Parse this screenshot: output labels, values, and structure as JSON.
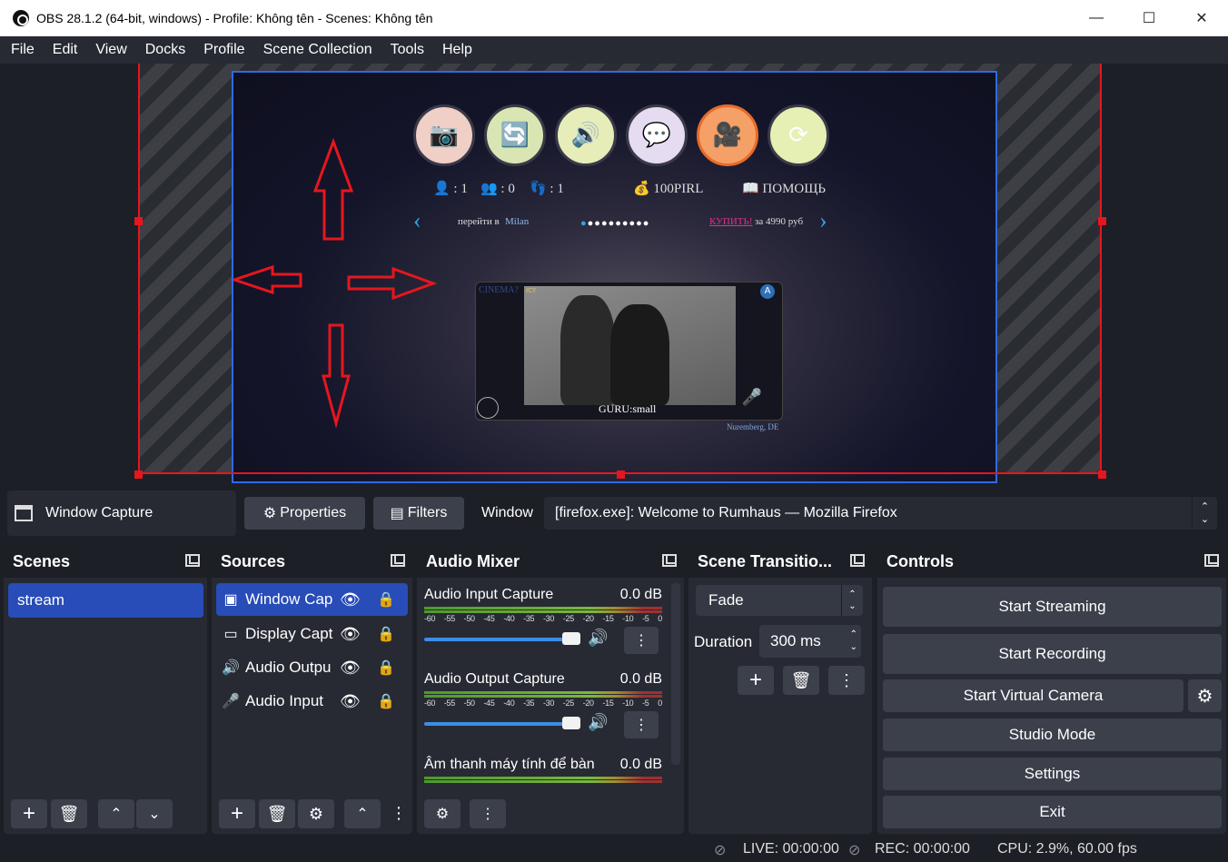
{
  "window": {
    "title": "OBS 28.1.2 (64-bit, windows) - Profile: Không tên - Scenes: Không tên"
  },
  "menu": [
    "File",
    "Edit",
    "View",
    "Docks",
    "Profile",
    "Scene Collection",
    "Tools",
    "Help"
  ],
  "preview": {
    "stats": {
      "users": "👤 : 1",
      "pairs": "👥 : 0",
      "feet": "👣 : 1",
      "currency": "💰 100PIRL",
      "help": "📖 ПОМОЩЬ"
    },
    "nav": {
      "goto_prefix": "перейти в",
      "goto_city": "Milan",
      "buy_link": "КУПИТЬ!",
      "buy_price": "за 4990 руб"
    },
    "video": {
      "corner_text": "CINEMA?",
      "corner_badge": "A",
      "caption": "GURU:small",
      "location": "Nuremberg, DE",
      "small_tag": "ICY"
    }
  },
  "source_toolbar": {
    "source_name": "Window Capture",
    "properties_label": "Properties",
    "filters_label": "Filters",
    "window_label": "Window",
    "window_value": "[firefox.exe]: Welcome to Rumhaus — Mozilla Firefox"
  },
  "scenes": {
    "title": "Scenes",
    "items": [
      "stream"
    ]
  },
  "sources": {
    "title": "Sources",
    "items": [
      {
        "label": "Window Cap",
        "icon": "window-capture-icon"
      },
      {
        "label": "Display Capt",
        "icon": "display-capture-icon"
      },
      {
        "label": "Audio Outpu",
        "icon": "speaker-icon"
      },
      {
        "label": "Audio Input",
        "icon": "microphone-icon"
      }
    ]
  },
  "mixer": {
    "title": "Audio Mixer",
    "scale": [
      "-60",
      "-55",
      "-50",
      "-45",
      "-40",
      "-35",
      "-30",
      "-25",
      "-20",
      "-15",
      "-10",
      "-5",
      "0"
    ],
    "channels": [
      {
        "name": "Audio Input Capture",
        "level": "0.0 dB"
      },
      {
        "name": "Audio Output Capture",
        "level": "0.0 dB"
      },
      {
        "name": "Âm thanh máy tính để bàn",
        "level": "0.0 dB"
      }
    ]
  },
  "transitions": {
    "title": "Scene Transitio...",
    "selected": "Fade",
    "duration_label": "Duration",
    "duration_value": "300 ms"
  },
  "controls": {
    "title": "Controls",
    "start_streaming": "Start Streaming",
    "start_recording": "Start Recording",
    "start_virtual_camera": "Start Virtual Camera",
    "studio_mode": "Studio Mode",
    "settings": "Settings",
    "exit": "Exit"
  },
  "status": {
    "live": "LIVE: 00:00:00",
    "rec": "REC: 00:00:00",
    "cpu": "CPU: 2.9%, 60.00 fps"
  },
  "colors": {
    "accent_blue": "#284cb8",
    "frame_red": "#e6161e",
    "frame_blue": "#2d6be4",
    "panel": "#272a33",
    "background": "#1d1f26"
  }
}
